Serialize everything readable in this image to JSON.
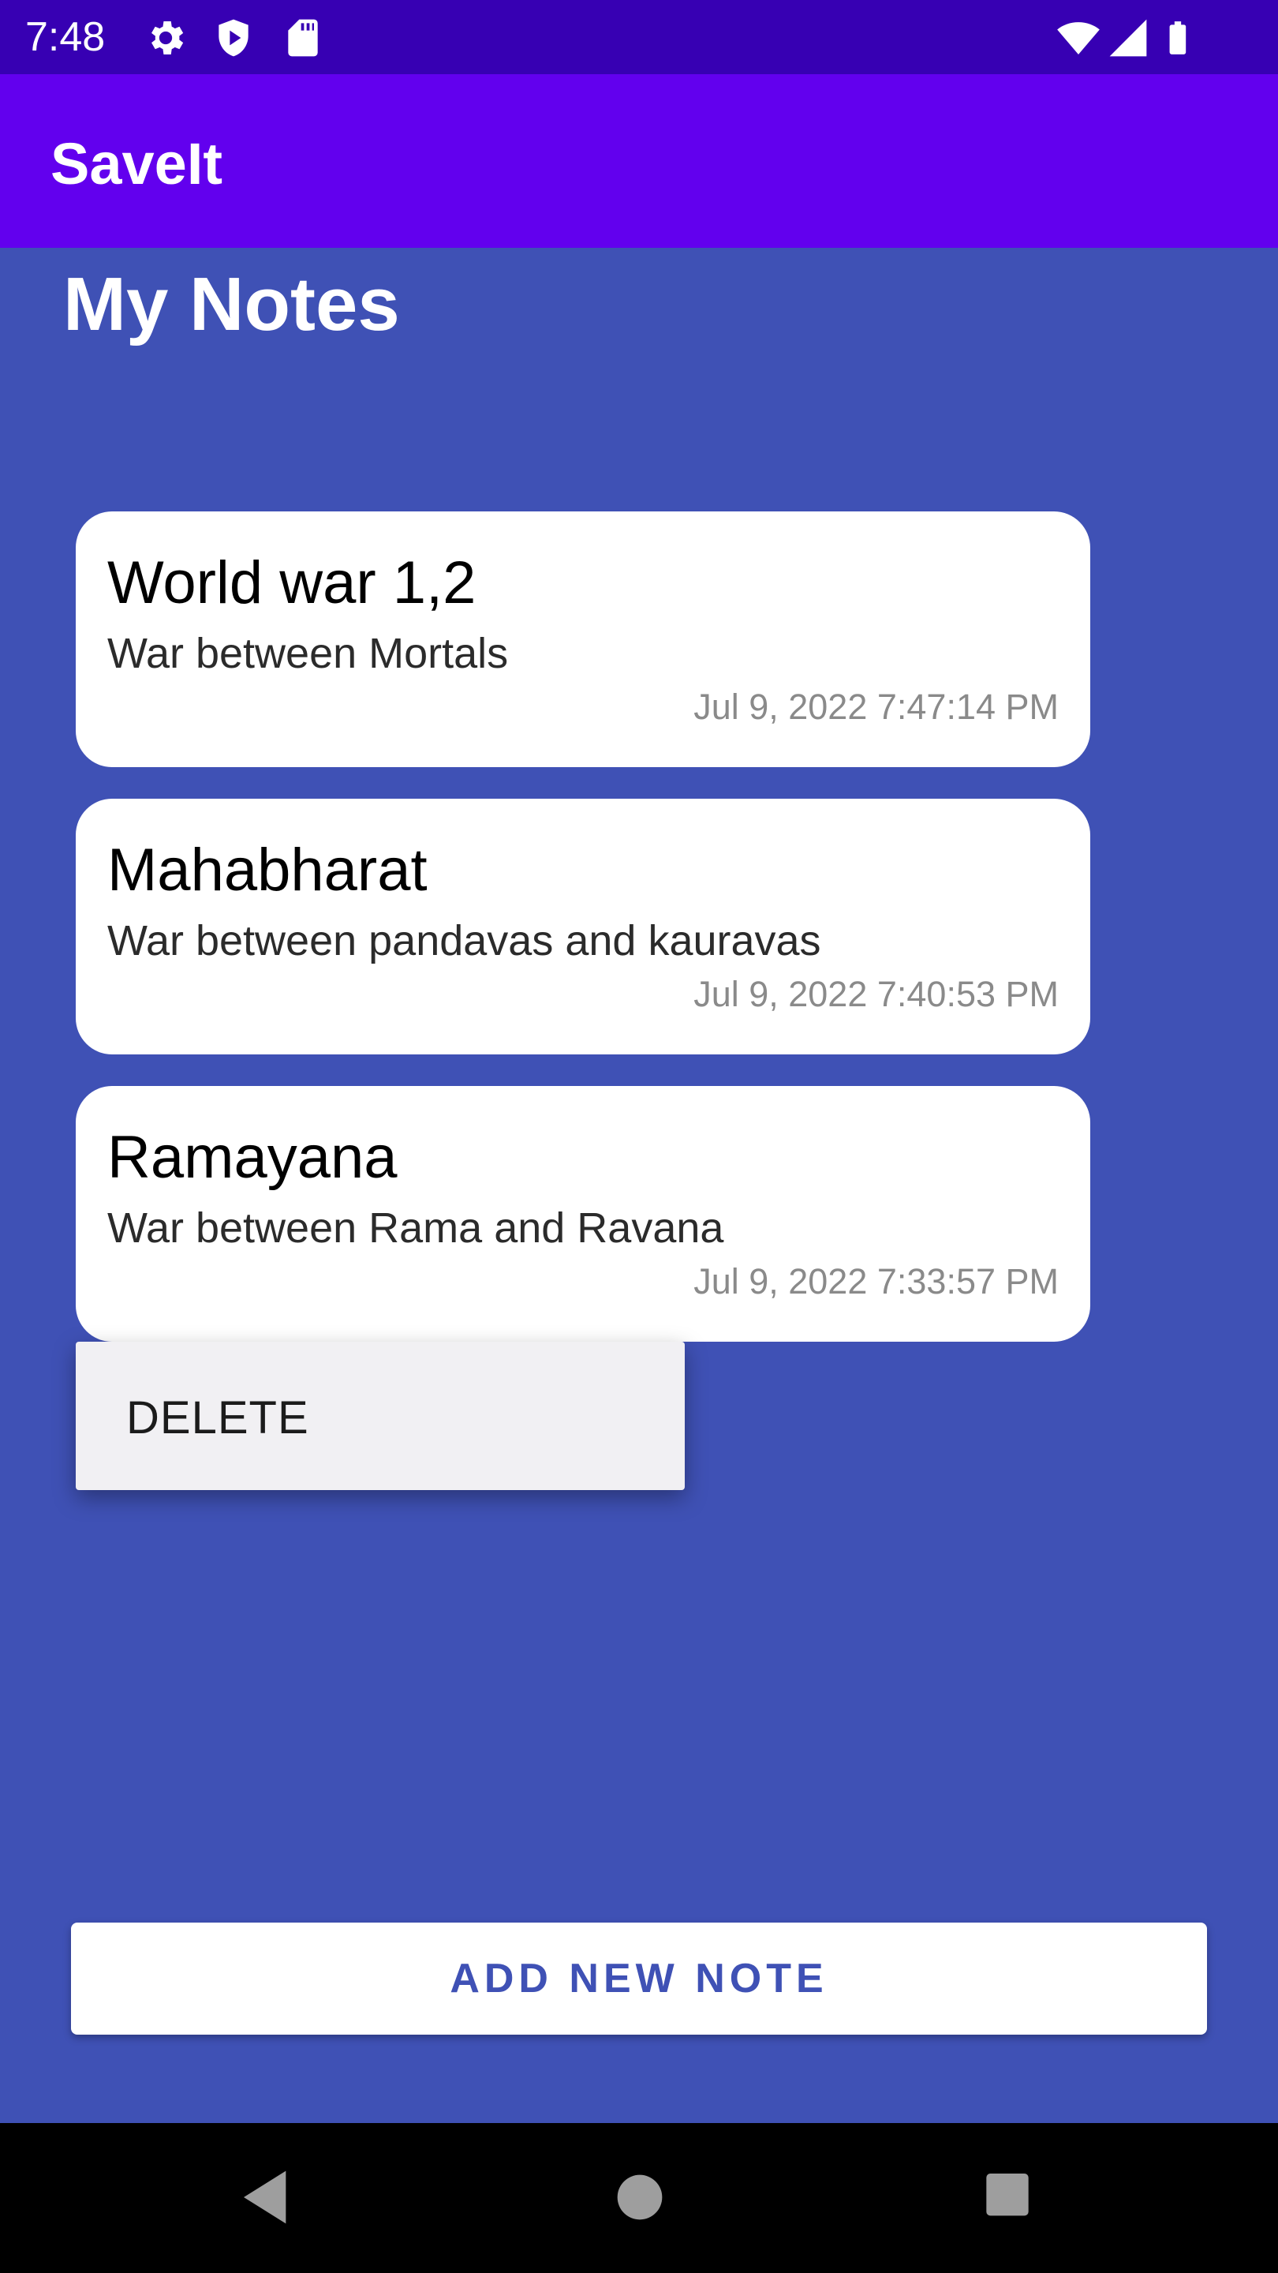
{
  "status_bar": {
    "time": "7:48",
    "icons": [
      "gear-icon",
      "shield-play-icon",
      "sd-card-icon",
      "wifi-icon",
      "signal-icon",
      "battery-icon"
    ]
  },
  "app_bar": {
    "title": "SaveIt"
  },
  "page": {
    "title": "My Notes"
  },
  "notes": [
    {
      "title": "World war 1,2",
      "description": "War between Mortals",
      "timestamp": "Jul 9, 2022 7:47:14 PM"
    },
    {
      "title": "Mahabharat",
      "description": "War between pandavas and kauravas",
      "timestamp": "Jul 9, 2022 7:40:53 PM"
    },
    {
      "title": "Ramayana",
      "description": "War between Rama and Ravana",
      "timestamp": "Jul 9, 2022 7:33:57 PM"
    }
  ],
  "context_menu": {
    "items": [
      {
        "label": "DELETE"
      }
    ]
  },
  "actions": {
    "add_note_label": "ADD NEW NOTE"
  },
  "nav_bar": {
    "icons": [
      "back-icon",
      "home-icon",
      "recents-icon"
    ]
  },
  "colors": {
    "status_bar": "#3700b3",
    "app_bar": "#6200ee",
    "background": "#3f51b5",
    "card": "#ffffff",
    "button_text": "#3f51b5"
  }
}
